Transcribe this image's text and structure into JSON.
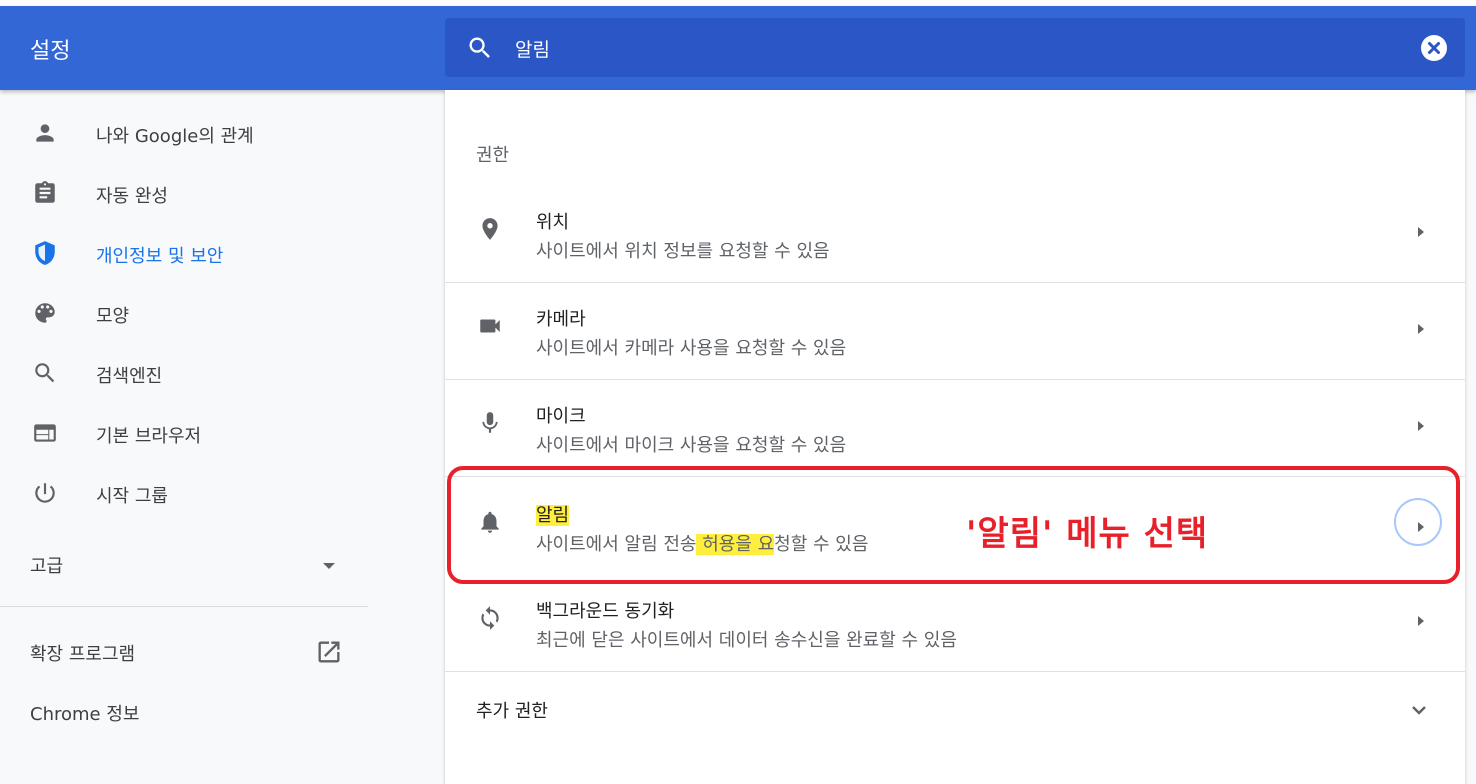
{
  "header": {
    "title": "설정",
    "search_value": "알림"
  },
  "sidebar": {
    "items": [
      {
        "label": "나와 Google의 관계",
        "icon": "person-icon"
      },
      {
        "label": "자동 완성",
        "icon": "clipboard-icon"
      },
      {
        "label": "개인정보 및 보안",
        "icon": "shield-icon",
        "active": true
      },
      {
        "label": "모양",
        "icon": "palette-icon"
      },
      {
        "label": "검색엔진",
        "icon": "search-icon"
      },
      {
        "label": "기본 브라우저",
        "icon": "browser-window-icon"
      },
      {
        "label": "시작 그룹",
        "icon": "power-icon"
      }
    ],
    "advanced": "고급",
    "extensions": "확장 프로그램",
    "about": "Chrome 정보"
  },
  "content": {
    "section_title": "권한",
    "permissions": [
      {
        "title": "위치",
        "subtitle": "사이트에서 위치 정보를 요청할 수 있음",
        "icon": "location-pin-icon"
      },
      {
        "title": "카메라",
        "subtitle": "사이트에서 카메라 사용을 요청할 수 있음",
        "icon": "camera-icon"
      },
      {
        "title": "마이크",
        "subtitle": "사이트에서 마이크 사용을 요청할 수 있음",
        "icon": "microphone-icon"
      },
      {
        "title": "알림",
        "subtitle_pre": "사이트에서 알림 전송",
        "subtitle_hl": " 허용을 요",
        "subtitle_post": "청할 수 있음",
        "icon": "bell-icon"
      },
      {
        "title": "백그라운드 동기화",
        "subtitle": "최근에 닫은 사이트에서 데이터 송수신을 완료할 수 있음",
        "icon": "sync-icon"
      }
    ],
    "extra": "추가 권한"
  },
  "annotation": {
    "text": "'알림' 메뉴 선택",
    "color": "#e8202a"
  },
  "colors": {
    "header": "#3367d6",
    "search_bg": "#2a56c6",
    "accent": "#1a73e8",
    "highlight": "#ffef3c"
  }
}
